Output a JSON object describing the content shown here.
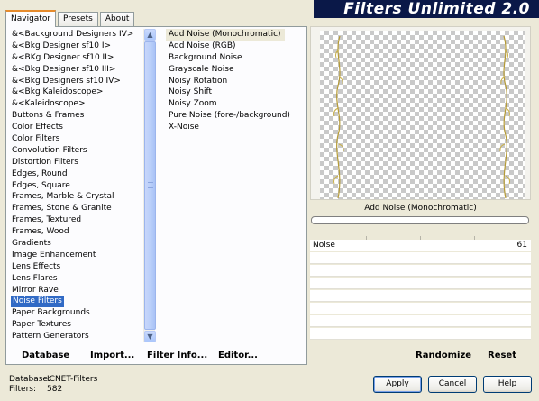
{
  "tabs": [
    {
      "label": "Navigator",
      "active": true
    },
    {
      "label": "Presets",
      "active": false
    },
    {
      "label": "About",
      "active": false
    }
  ],
  "banner": {
    "title": "Filters Unlimited 2.0"
  },
  "categories": [
    "&<Background Designers IV>",
    "&<Bkg Designer sf10 I>",
    "&<BKg Designer sf10 II>",
    "&<Bkg Designer sf10 III>",
    "&<Bkg Designers sf10 IV>",
    "&<Bkg Kaleidoscope>",
    "&<Kaleidoscope>",
    "Buttons & Frames",
    "Color Effects",
    "Color Filters",
    "Convolution Filters",
    "Distortion Filters",
    "Edges, Round",
    "Edges, Square",
    "Frames, Marble & Crystal",
    "Frames, Stone & Granite",
    "Frames, Textured",
    "Frames, Wood",
    "Gradients",
    "Image Enhancement",
    "Lens Effects",
    "Lens Flares",
    "Mirror Rave",
    "Noise Filters",
    "Paper Backgrounds",
    "Paper Textures",
    "Pattern Generators"
  ],
  "selected_category": "Noise Filters",
  "filters": [
    "Add Noise (Monochromatic)",
    "Add Noise (RGB)",
    "Background Noise",
    "Grayscale Noise",
    "Noisy Rotation",
    "Noisy Shift",
    "Noisy Zoom",
    "Pure Noise (fore-/background)",
    "X-Noise"
  ],
  "selected_filter": "Add Noise (Monochromatic)",
  "left_links": {
    "database": "Database",
    "import": "Import...",
    "filter_info": "Filter Info...",
    "editor": "Editor..."
  },
  "preview": {
    "caption": "Add Noise (Monochromatic)",
    "progress": 0
  },
  "params": [
    {
      "label": "Noise",
      "value": "61"
    }
  ],
  "right_links": {
    "randomize": "Randomize",
    "reset": "Reset"
  },
  "status": {
    "database_label": "Database:",
    "database_value": "ICNET-Filters",
    "filters_label": "Filters:",
    "filters_value": "582"
  },
  "buttons": {
    "apply": "Apply",
    "cancel": "Cancel",
    "help": "Help"
  },
  "icons": {
    "scroll_up": "chevron-up-icon",
    "scroll_down": "chevron-down-icon"
  },
  "colors": {
    "banner": "#0a1848",
    "selection": "#316ac5",
    "tab_accent": "#e68b2c"
  }
}
